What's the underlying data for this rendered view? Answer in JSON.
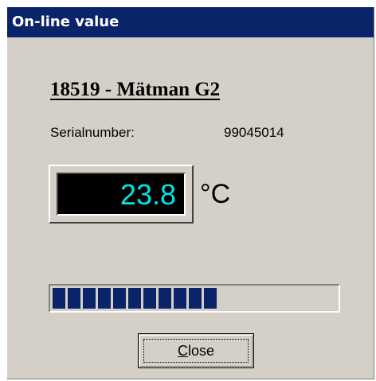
{
  "window": {
    "title": "On-line value"
  },
  "device": {
    "title": "18519 - Mätman G2",
    "serial_label": "Serialnumber:",
    "serial_value": "99045014"
  },
  "reading": {
    "value": "23.8",
    "unit": "°C",
    "color": "#00e5e5"
  },
  "progress": {
    "filled_segments": 11,
    "total_segments": 20,
    "fraction": 0.55,
    "color": "#0a246a"
  },
  "buttons": {
    "close_mnemonic": "C",
    "close_rest": "lose"
  }
}
